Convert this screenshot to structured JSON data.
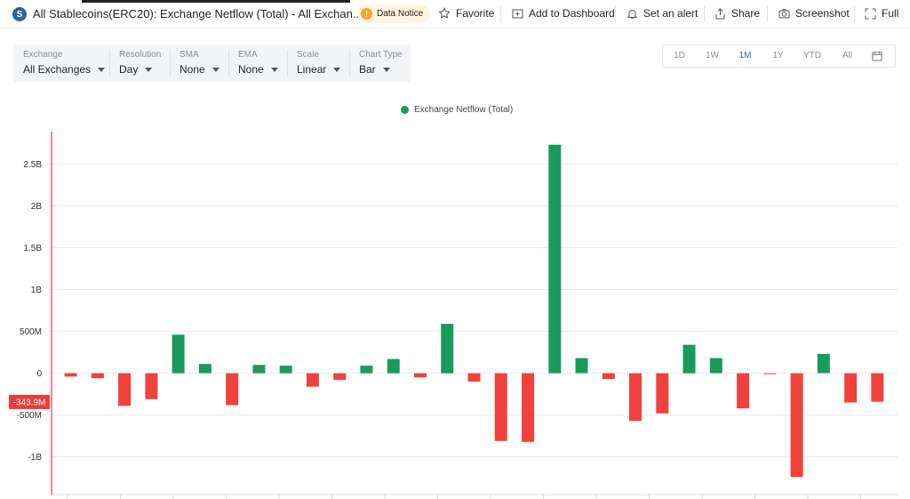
{
  "header": {
    "logo_letter": "S",
    "title": "All Stablecoins(ERC20): Exchange Netflow (Total) - All Exchan...",
    "notice_label": "Data Notice",
    "favorite_label": "Favorite",
    "dashboard_label": "Add to Dashboard",
    "alert_label": "Set an alert",
    "share_label": "Share",
    "screenshot_label": "Screenshot",
    "full_label": "Full"
  },
  "controls": [
    {
      "label": "Exchange",
      "value": "All Exchanges"
    },
    {
      "label": "Resolution",
      "value": "Day"
    },
    {
      "label": "SMA",
      "value": "None"
    },
    {
      "label": "EMA",
      "value": "None"
    },
    {
      "label": "Scale",
      "value": "Linear"
    },
    {
      "label": "Chart Type",
      "value": "Bar"
    }
  ],
  "ranges": [
    "1D",
    "1W",
    "1M",
    "1Y",
    "YTD",
    "All"
  ],
  "active_range": "1M",
  "colors": {
    "positive": "#1a9a5c",
    "negative": "#f0413c",
    "marker": "#ee3b3b",
    "grid": "#ececec"
  },
  "chart_data": {
    "type": "bar",
    "legend": [
      {
        "name": "Exchange Netflow (Total)",
        "color": "#1a9a5c"
      }
    ],
    "legend_position": "top-center",
    "grid": true,
    "ylim": [
      -1.45,
      2.95
    ],
    "yticks": [
      {
        "value": 2.5,
        "label": "2.5B"
      },
      {
        "value": 2.0,
        "label": "2B"
      },
      {
        "value": 1.5,
        "label": "1.5B"
      },
      {
        "value": 1.0,
        "label": "1B"
      },
      {
        "value": 0.5,
        "label": "500M"
      },
      {
        "value": 0,
        "label": "0"
      },
      {
        "value": -0.5,
        "label": "-500M"
      },
      {
        "value": -1.0,
        "label": "-1B"
      }
    ],
    "current_value_marker": {
      "value": -0.3439,
      "label": "-343.9M"
    },
    "series": [
      {
        "name": "Exchange Netflow (Total)",
        "unit": "B",
        "values": [
          -0.04,
          -0.06,
          -0.39,
          -0.31,
          0.46,
          0.11,
          -0.38,
          0.1,
          0.09,
          -0.16,
          -0.08,
          0.09,
          0.17,
          -0.05,
          0.59,
          -0.1,
          -0.81,
          -0.82,
          2.73,
          0.18,
          -0.07,
          -0.57,
          -0.48,
          0.34,
          0.18,
          -0.42,
          -0.01,
          -1.24,
          0.23,
          -0.35,
          -0.34
        ]
      }
    ]
  }
}
